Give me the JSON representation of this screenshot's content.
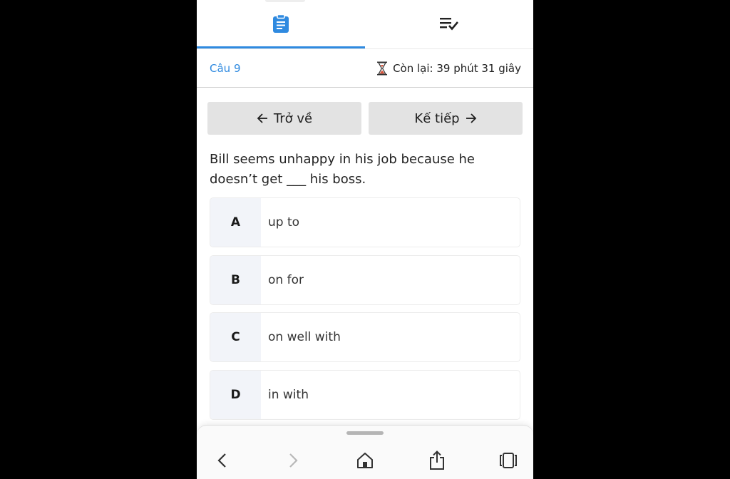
{
  "tabs": {
    "active": "question",
    "items": [
      {
        "id": "question",
        "icon": "clipboard-icon"
      },
      {
        "id": "list",
        "icon": "checklist-icon"
      }
    ]
  },
  "status": {
    "question_label": "Câu 9",
    "timer_text": "Còn lại: 39 phút 31 giây",
    "timer_icon": "hourglass-icon"
  },
  "navigation": {
    "back_label": "Trở về",
    "next_label": "Kế tiếp"
  },
  "question": {
    "text": "Bill seems unhappy in his job because he doesn’t get ___ his boss."
  },
  "options": [
    {
      "letter": "A",
      "text": "up to"
    },
    {
      "letter": "B",
      "text": "on for"
    },
    {
      "letter": "C",
      "text": "on well with"
    },
    {
      "letter": "D",
      "text": "in with"
    }
  ],
  "browser_toolbar": {
    "items": [
      "back-icon",
      "forward-icon",
      "home-icon",
      "share-icon",
      "tabs-icon"
    ]
  },
  "colors": {
    "accent": "#2f8ae0",
    "button_bg": "#e3e3e3",
    "option_letter_bg": "#f2f4f9",
    "hourglass_sand": "#d9533b"
  }
}
